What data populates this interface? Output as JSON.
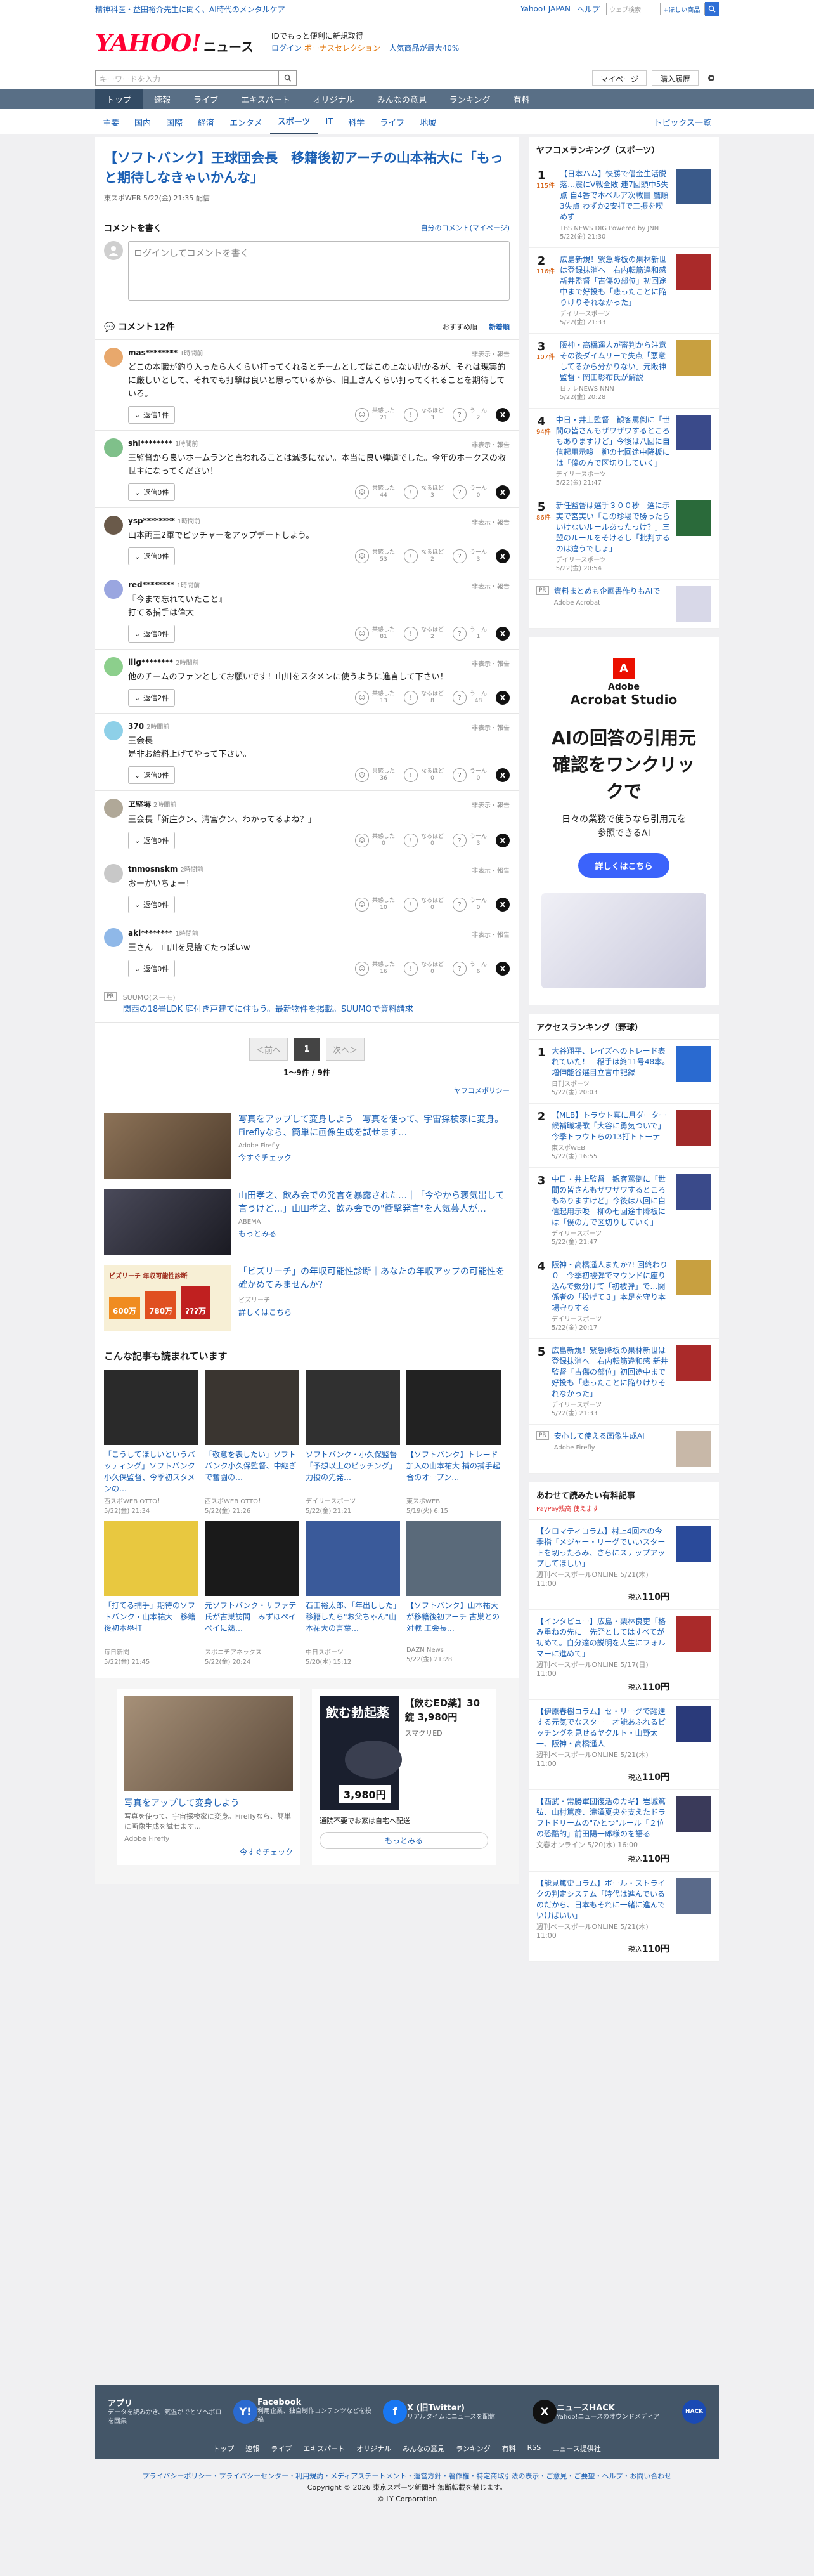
{
  "topstrip": {
    "promo": "精神科医・益田裕介先生に聞く、AI時代のメンタルケア",
    "links": [
      "Yahoo! JAPAN",
      "ヘルプ"
    ],
    "search_placeholder": "ウェブ検索",
    "search_button": "+ほしい商品",
    "search_go": "Q"
  },
  "header": {
    "logo_main": "YAHOO!",
    "logo_sub": "JAPAN",
    "logo_news": "ニュース",
    "promo_line1": "IDでもっと便利に新規取得",
    "promo_login": "ログイン",
    "promo_bonus": "ボーナスセレクション",
    "promo_popular": "人気商品が最大40%"
  },
  "searchbar": {
    "placeholder": "キーワードを入力",
    "mypage": "マイページ",
    "history": "購入履歴"
  },
  "nav": {
    "items": [
      "トップ",
      "速報",
      "ライブ",
      "エキスパート",
      "オリジナル",
      "みんなの意見",
      "ランキング",
      "有料"
    ],
    "active": "トップ"
  },
  "subnav": {
    "items": [
      "主要",
      "国内",
      "国際",
      "経済",
      "エンタメ",
      "スポーツ",
      "IT",
      "科学",
      "ライフ",
      "地域"
    ],
    "active": "スポーツ",
    "topics": "トピックス一覧"
  },
  "article": {
    "title": "【ソフトバンク】王球団会長　移籍後初アーチの山本祐大に「もっと期待しなきゃいかんな」",
    "source": "東スポWEB",
    "date": "5/22(金) 21:35 配信"
  },
  "comment_write": {
    "title": "コメントを書く",
    "my_comments": "自分のコメント(マイページ)",
    "placeholder": "ログインしてコメントを書く"
  },
  "comments": {
    "header": "コメント12件",
    "sort_recommended": "おすすめ順",
    "sort_new": "新着順",
    "labels": {
      "helpful": "共感した",
      "insightful": "なるほど",
      "hmm": "うーん",
      "report": "非表示・報告"
    },
    "items": [
      {
        "user": "mas********",
        "time": "1時間前",
        "text": "どこの本職が釣り入ったら人くらい打ってくれるとチームとしてはこの上ない助かるが、それは現実的に厳しいとして、それでも打撃は良いと思っているから、旧上さんくらい打ってくれることを期待している。",
        "replies": "返信1件",
        "helpful": "21",
        "insightful": "3",
        "hmm": "2",
        "color": "#e8a86c"
      },
      {
        "user": "shi********",
        "time": "1時間前",
        "text": "王監督から良いホームランと言われることは滅多にない。本当に良い弾道でした。今年のホークスの救世主になってください！",
        "replies": "返信0件",
        "helpful": "44",
        "insightful": "3",
        "hmm": "0",
        "color": "#7fc08a"
      },
      {
        "user": "ysp********",
        "time": "1時間前",
        "text": "山本両王2軍でピッチャーをアップデートしよう。",
        "replies": "返信0件",
        "helpful": "53",
        "insightful": "2",
        "hmm": "3",
        "color": "#6a5a4a"
      },
      {
        "user": "red********",
        "time": "1時間前",
        "text": "『今まで忘れていたこと』\n打てる捕手は偉大",
        "replies": "返信0件",
        "helpful": "81",
        "insightful": "2",
        "hmm": "1",
        "color": "#9aa6e0"
      },
      {
        "user": "iiig********",
        "time": "2時間前",
        "text": "他のチームのファンとしてお願いです！山川をスタメンに使うように進言して下さい！",
        "replies": "返信2件",
        "helpful": "13",
        "insightful": "8",
        "hmm": "48",
        "color": "#8ccf8c"
      },
      {
        "user": "370",
        "time": "2時間前",
        "text": "王会長\n是非お給料上げてやって下さい。",
        "replies": "返信0件",
        "helpful": "36",
        "insightful": "0",
        "hmm": "0",
        "color": "#8ed0e8"
      },
      {
        "user": "ヱ堅堺",
        "time": "2時間前",
        "text": "王会長「新庄クン、清宮クン、わかってるよね？」",
        "replies": "返信0件",
        "helpful": "0",
        "insightful": "0",
        "hmm": "3",
        "color": "#b0a898"
      },
      {
        "user": "tnmosnskm",
        "time": "2時間前",
        "text": "おーかいちょー！",
        "replies": "返信0件",
        "helpful": "10",
        "insightful": "0",
        "hmm": "0",
        "color": "#c8c8c8"
      },
      {
        "user": "aki********",
        "time": "1時間前",
        "text": "王さん　山川を見捨てたっぽいw",
        "replies": "返信0件",
        "helpful": "16",
        "insightful": "0",
        "hmm": "6",
        "color": "#8fb8e8"
      }
    ]
  },
  "pr_row": {
    "source": "SUUMO(スーモ)",
    "text": "関西の18畳LDK 庭付き戸建てに住もう。最新物件を掲載。SUUMOで資料請求",
    "badge": "PR"
  },
  "pager": {
    "prev": "＜前へ",
    "current": "1",
    "next": "次へ＞",
    "count": "1〜9件 / 9件",
    "policy": "ヤフコメポリシー"
  },
  "ads": [
    {
      "title": "写真をアップして変身しよう｜写真を使って、宇宙探検家に変身。Fireflyなら、簡単に画像生成を試せます…",
      "source": "Adobe Firefly",
      "cta": "今すぐチェック",
      "color": "#6e5a46"
    },
    {
      "title": "山田孝之、飲み会での発言を暴露された…｜「今やから褒気出して言うけど…」山田孝之、飲み会での\"衝撃発言\"を人気芸人が…",
      "source": "ABEMA",
      "cta": "もっとみる",
      "color": "#3a3a4a"
    },
    {
      "title": "「ビズリーチ」の年収可能性診断｜あなたの年収アップの可能性を確かめてみませんか？",
      "source": "ビズリーチ",
      "cta": "詳しくはこちら",
      "color": "#f4e9c8"
    }
  ],
  "ad_chart": {
    "title": "ビズリーチ 年収可能性診断",
    "values": [
      "600万",
      "780万",
      "???万"
    ]
  },
  "readalso": {
    "title": "こんな記事も読まれています",
    "items": [
      {
        "title": "「こうしてほしいというバッティング」ソフトバンク小久保監督、今季初スタメンの…",
        "source": "西スポWEB OTTO！",
        "date": "5/22(金) 21:34",
        "color": "#2a2a2a"
      },
      {
        "title": "「敬意を表したい」ソフトバンク小久保監督、中継ぎで奮闘の…",
        "source": "西スポWEB OTTO！",
        "date": "5/22(金) 21:26",
        "color": "#3a3530"
      },
      {
        "title": "ソフトバンク・小久保監督「予想以上のピッチング」力投の先発…",
        "source": "デイリースポーツ",
        "date": "5/22(金) 21:21",
        "color": "#303030"
      },
      {
        "title": "【ソフトバンク】トレード加入の山本祐大 捕の捕手起合のオープン…",
        "source": "東スポWEB",
        "date": "5/19(火) 6:15",
        "color": "#222"
      },
      {
        "title": "「打てる捕手」期待のソフトバンク・山本祐大　移籍後初本塁打",
        "source": "毎日新聞",
        "date": "5/22(金) 21:45",
        "color": "#e8c840"
      },
      {
        "title": "元ソフトバンク・サファテ氏が古巣訪問　みずほペイペイに熱…",
        "source": "スポニチアネックス",
        "date": "5/22(金) 20:24",
        "color": "#1a1a1a"
      },
      {
        "title": "石田裕太郎、「年出しした」移籍したら\"お父ちゃん\"山本祐大の言葉…",
        "source": "中日スポーツ",
        "date": "5/20(水) 15:12",
        "color": "#3a5a9a"
      },
      {
        "title": "【ソフトバンク】山本祐大が移籍後初アーチ 古巣との対戦 王会長…",
        "source": "DAZN News",
        "date": "5/22(金) 21:28",
        "color": "#5a6a7a"
      }
    ]
  },
  "adpair": [
    {
      "title": "写真をアップして変身しよう",
      "desc": "写真を使って、宇宙探検家に変身。Fireflyなら、簡単に画像生成を試せます…",
      "source": "Adobe Firefly",
      "cta": "今すぐチェック"
    },
    {
      "headline": "飲む勃起薬",
      "title": "【飲むED薬】30錠 3,980円",
      "price": "3,980円",
      "desc": "スマクリED",
      "sub": "通院不要でお家は自宅へ配送",
      "cta": "もっとみる"
    }
  ],
  "ranking_sports": {
    "title": "ヤフコメランキング（スポーツ）",
    "items": [
      {
        "rank": "1",
        "count": "115件",
        "title": "【日本ハム】快勝で借金生活脱落…震にV戦全敗 連7回頭中5失点 自4番で本ベルア次戦目 鷹順3失点 わずか2安打で三振を喫めず",
        "source": "TBS NEWS DIG Powered by JNN",
        "date": "5/22(金) 21:30",
        "color": "#3a5a8a"
      },
      {
        "rank": "2",
        "count": "116件",
        "title": "広島新規！緊急降板の果林新世は登録抹消へ　右内転筋違和感 新井監督「古傷の部位」初回途中まで好投も「悲ったことに陥りけりそれなかった」",
        "source": "デイリースポーツ",
        "date": "5/22(金) 21:33",
        "color": "#aa2a2a"
      },
      {
        "rank": "3",
        "count": "107件",
        "title": "阪神・高橋遥人が審判から注意その後ダイムリーで失点「悪意してるから分かりない」元阪神監督・岡田彰布氏が解説",
        "source": "日テレNEWS NNN",
        "date": "5/22(金) 20:28",
        "color": "#c8a040"
      },
      {
        "rank": "4",
        "count": "94件",
        "title": "中日・井上監督　観客罵倒に「世間の皆さんもザワザワするところもありますけど」今後は八回に自信起用示唆　柳の七回途中降板には「僕の方で区切りしていく」",
        "source": "デイリースポーツ",
        "date": "5/22(金) 21:47",
        "color": "#3a4a8a"
      },
      {
        "rank": "5",
        "count": "86件",
        "title": "新任監督は選手３００秒　選に示実で宮実い「この珍場で勝ったらいけないルールあったっけ？」三盟のルールをそけるし「批判するのは違うでしょ」",
        "source": "デイリースポーツ",
        "date": "5/22(金) 20:54",
        "color": "#2a6a3a"
      }
    ],
    "pr": {
      "title": "資料まとめも企画書作りもAIで",
      "source": "Adobe Acrobat"
    }
  },
  "adobe_ad": {
    "brand": "Adobe",
    "product": "Acrobat Studio",
    "headline": "AIの回答の引用元確認をワンクリックで",
    "sub": "日々の業務で使うなら引用元を参照できるAI",
    "cta": "詳しくはこちら",
    "accent": "#eb1000"
  },
  "ranking_access": {
    "title": "アクセスランキング（野球）",
    "items": [
      {
        "rank": "1",
        "title": "大谷翔平、レイズへのトレード表れていた！　稲手は終11号48本。増伸能谷選目立言中記録",
        "source": "日刊スポーツ",
        "date": "5/22(金) 20:03",
        "color": "#2a6ad0"
      },
      {
        "rank": "2",
        "title": "【MLB】トラウト真に月ダーター候補職場歌「大谷に勇気ついで」今季トラウトらの13打トトーテ",
        "source": "東スポWEB",
        "date": "5/22(金) 16:55",
        "color": "#a02a2a"
      },
      {
        "rank": "3",
        "title": "中日・井上監督　観客罵倒に「世間の皆さんもザワザワするところもありますけど」今後は八回に自信起用示唆　柳の七回途中降板には「僕の方で区切りしていく」",
        "source": "デイリースポーツ",
        "date": "5/22(金) 21:47",
        "color": "#3a4a8a"
      },
      {
        "rank": "4",
        "title": "阪神・高橋遥人またか?! 回終わり０　今季初被弾でマウンドに座り込んで数分けて「初被弾」で…関係者の「投げて３」本足を守り本場守りする",
        "source": "デイリースポーツ",
        "date": "5/22(金) 20:17",
        "color": "#c8a040"
      },
      {
        "rank": "5",
        "title": "広島新規！緊急降板の果林新世は登録抹消へ　右内転筋違和感 新井監督「古傷の部位」初回途中まで好投も「悲ったことに陥りけりそれなかった」",
        "source": "デイリースポーツ",
        "date": "5/22(金) 21:33",
        "color": "#aa2a2a"
      }
    ],
    "pr": {
      "title": "安心して使える画像生成AI",
      "source": "Adobe Firefly"
    }
  },
  "shopping": {
    "title": "あわせて読みたい有料記事",
    "paypay": "PayPay残高 使えます",
    "price_label": "税込",
    "items": [
      {
        "title": "【クロマティコラム】村上4回本の今季指「メジャー・リーグでいいスタートを切ったろみ、さらにステップアップしてほしい」",
        "source": "週刊ベースボールONLINE",
        "date": "5/21(木) 11:00",
        "price": "110円",
        "color": "#2a4a9a"
      },
      {
        "title": "【インタビュー】広島・栗林良吏「格み重ねの先に　先発としてはすべてが初めて。自分達の説明を人生にフォルマーに進めて」",
        "source": "週刊ベースボールONLINE",
        "date": "5/17(日) 11:00",
        "price": "110円",
        "color": "#aa2a2a"
      },
      {
        "title": "【伊原春樹コラム】セ・リーグで躍進する元気でなスター　才能あふれるピッチングを見せるヤクルト・山野太一、阪神・高橋遥人",
        "source": "週刊ベースボールONLINE",
        "date": "5/21(木) 11:00",
        "price": "110円",
        "color": "#2a3a7a"
      },
      {
        "title": "【西武・常勝軍団復活のカギ】岩城篤弘、山村篤彦、滝澤夏央を支えたドラフトドリームの\"ひとつ\"ルール「２位の恐酷的」前田陽一郎様のを語る",
        "source": "文春オンライン",
        "date": "5/20(水) 16:00",
        "price": "110円",
        "color": "#3a3a5a"
      },
      {
        "title": "【能見篤史コラム】ボール・ストライクの判定システム「時代は進んでいるのだから、日本もそれに一緒に進んでいけばいい」",
        "source": "週刊ベースボールONLINE",
        "date": "5/21(木) 11:00",
        "price": "110円",
        "color": "#5a6a8a"
      }
    ]
  },
  "footer": {
    "apps": [
      {
        "name": "アプリ",
        "desc": "データを読みかき、気温がでとソヘボロを団集",
        "icon": "Y!",
        "color": "#2a6ad0"
      },
      {
        "name": "Facebook",
        "desc": "利用企業、独自制作コンテンツなどを投稿",
        "icon": "f",
        "color": "#1877f2"
      },
      {
        "name": "X (旧Twitter)",
        "desc": "リアルタイムにニュースを配信",
        "icon": "X",
        "color": "#111111"
      },
      {
        "name": "ニュースHACK",
        "desc": "Yahoo!ニュースのオウンドメディア",
        "icon": "HACK",
        "color": "#1a4ab4"
      }
    ],
    "links": [
      "トップ",
      "速報",
      "ライブ",
      "エキスパート",
      "オリジナル",
      "みんなの意見",
      "ランキング",
      "有料",
      "RSS",
      "ニュース提供社"
    ],
    "legal": "プライバシーポリシー・プライバシーセンター・利用規約・メディアステートメント・運営方針・著作権・特定商取引法の表示・ご意見・ご要望・ヘルプ・お問い合わせ",
    "copyright1": "Copyright © 2026 東京スポーツ新聞社 無断転載を禁じます。",
    "copyright2": "© LY Corporation"
  }
}
